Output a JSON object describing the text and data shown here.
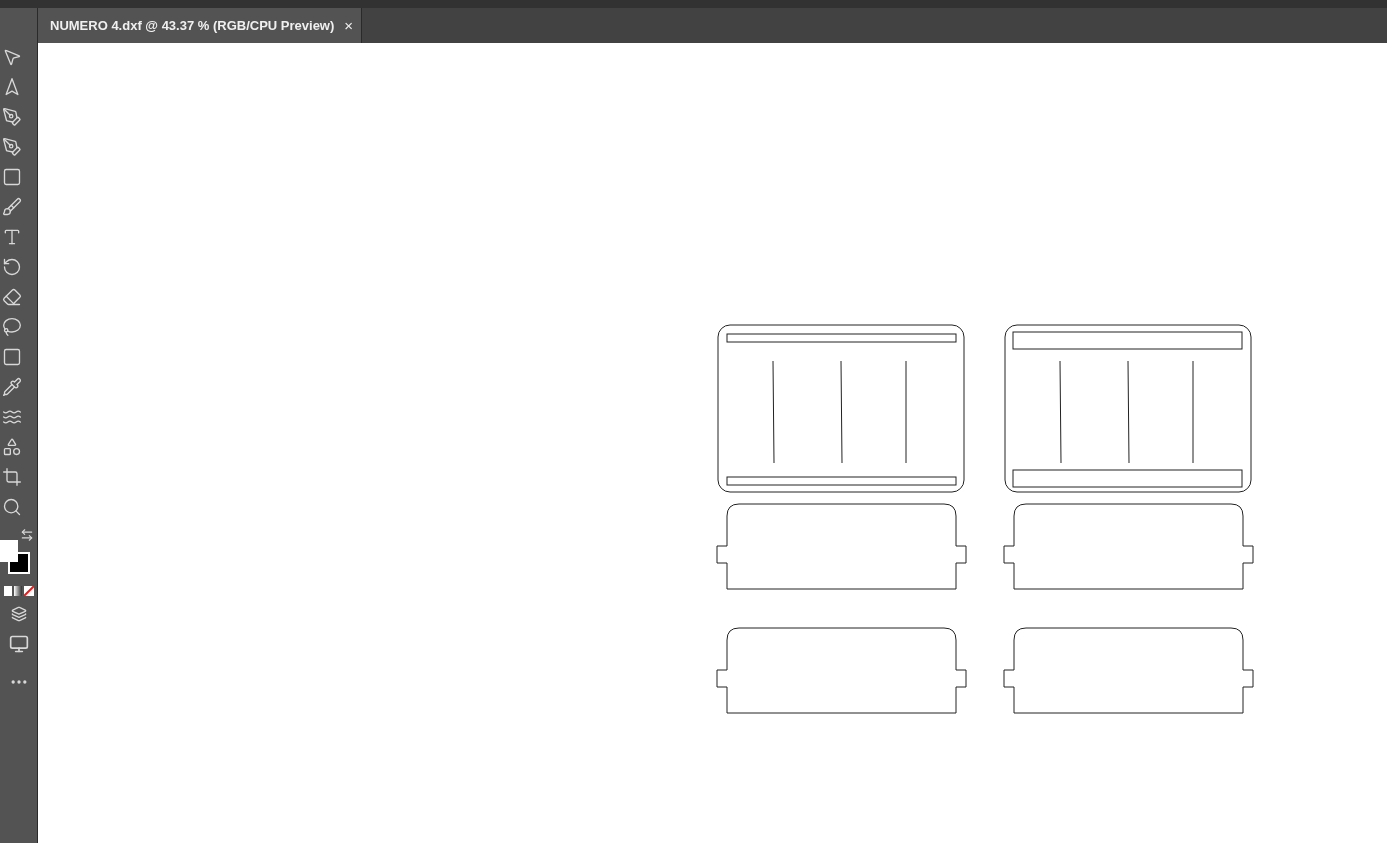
{
  "document_tab": {
    "title": "NUMERO 4.dxf @ 43.37 % (RGB/CPU Preview)",
    "close": "×"
  }
}
